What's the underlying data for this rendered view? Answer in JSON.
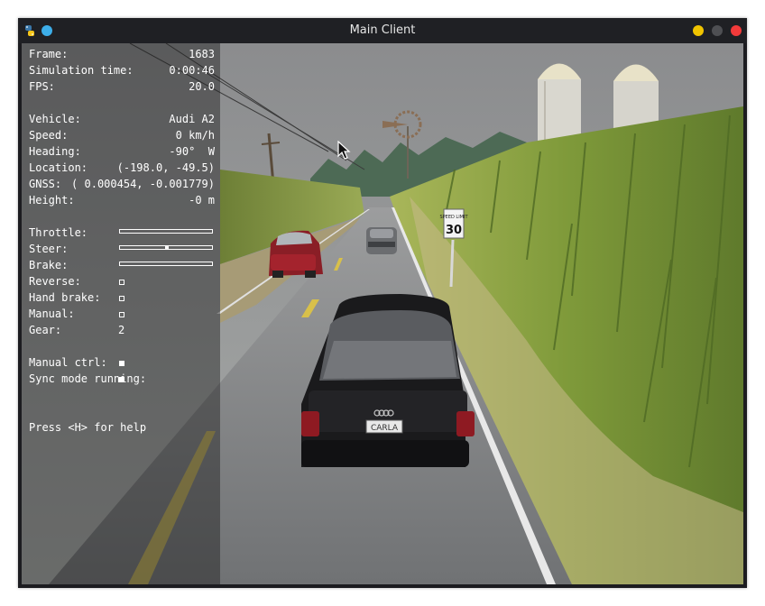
{
  "window": {
    "title": "Main Client",
    "app_icon": "python-icon"
  },
  "hud": {
    "frame_label": "Frame:",
    "frame_value": "1683",
    "sim_time_label": "Simulation time:",
    "sim_time_value": "0:00:46",
    "fps_label": "FPS:",
    "fps_value": "20.0",
    "vehicle_label": "Vehicle:",
    "vehicle_value": "Audi A2",
    "speed_label": "Speed:",
    "speed_value": "0 km/h",
    "heading_label": "Heading:",
    "heading_value": "-90°  W",
    "location_label": "Location:",
    "location_value": "(-198.0, -49.5)",
    "gnss_label": "GNSS:",
    "gnss_value": "( 0.000454, -0.001779)",
    "height_label": "Height:",
    "height_value": "-0 m",
    "throttle_label": "Throttle:",
    "throttle_level": 0.0,
    "steer_label": "Steer:",
    "steer_level": 0.0,
    "brake_label": "Brake:",
    "brake_level": 0.0,
    "reverse_label": "Reverse:",
    "reverse_on": false,
    "handbrake_label": "Hand brake:",
    "handbrake_on": false,
    "manual_label": "Manual:",
    "manual_on": false,
    "gear_label": "Gear:",
    "gear_value": "2",
    "manual_ctrl_label": "Manual ctrl:",
    "manual_ctrl_on": true,
    "sync_label": "Sync mode running:",
    "sync_on": true,
    "help_text": "Press <H> for help"
  },
  "scene": {
    "speed_sign_top": "SPEED LIMIT",
    "speed_sign_value": "30",
    "license_plate": "CARLA"
  },
  "colors": {
    "minimize": "#f0c400",
    "maximize": "#4e4f53",
    "close": "#f23a3a",
    "pin": "#3daee9",
    "titlebar": "#1f2024"
  }
}
